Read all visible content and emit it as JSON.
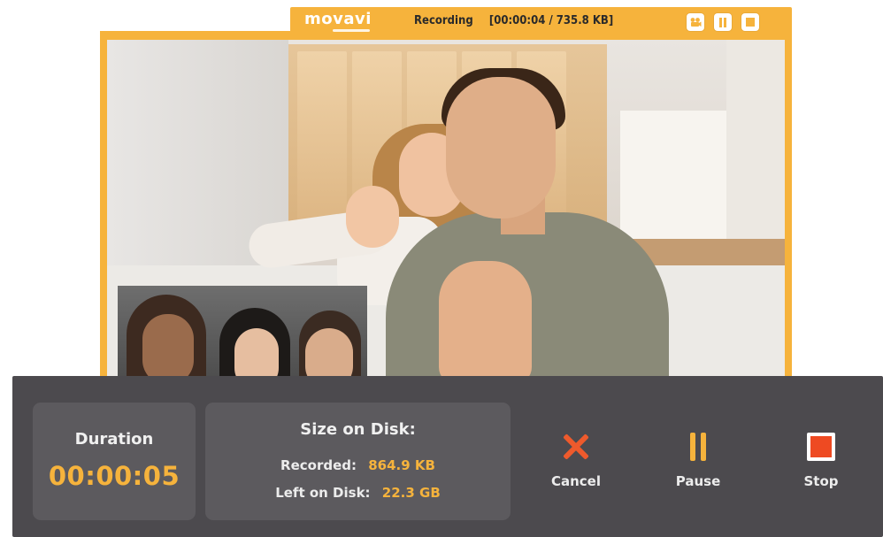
{
  "recorder_bar": {
    "logo_text": "movavi",
    "status_label": "Recording",
    "status_info": "[00:00:04 / 735.8 KB]",
    "buttons": [
      {
        "name": "webcam-button",
        "icon": "webcam-icon"
      },
      {
        "name": "pause-button",
        "icon": "pause-icon"
      },
      {
        "name": "stop-button",
        "icon": "stop-icon"
      }
    ],
    "accent_color": "#f6b33c"
  },
  "panel": {
    "duration_label": "Duration",
    "duration_value": "00:00:05",
    "size_title": "Size on Disk:",
    "recorded_label": "Recorded:",
    "recorded_value": "864.9 KB",
    "left_label": "Left on Disk:",
    "left_value": "22.3 GB",
    "actions": {
      "cancel_label": "Cancel",
      "pause_label": "Pause",
      "stop_label": "Stop"
    },
    "icons": {
      "cancel": "close-icon",
      "pause": "pause-icon",
      "stop": "stop-icon"
    },
    "colors": {
      "panel_bg": "#4c4a4e",
      "card_bg": "#5c5a5e",
      "value_accent": "#f6b33c",
      "cancel_red": "#ee5a2c"
    }
  }
}
